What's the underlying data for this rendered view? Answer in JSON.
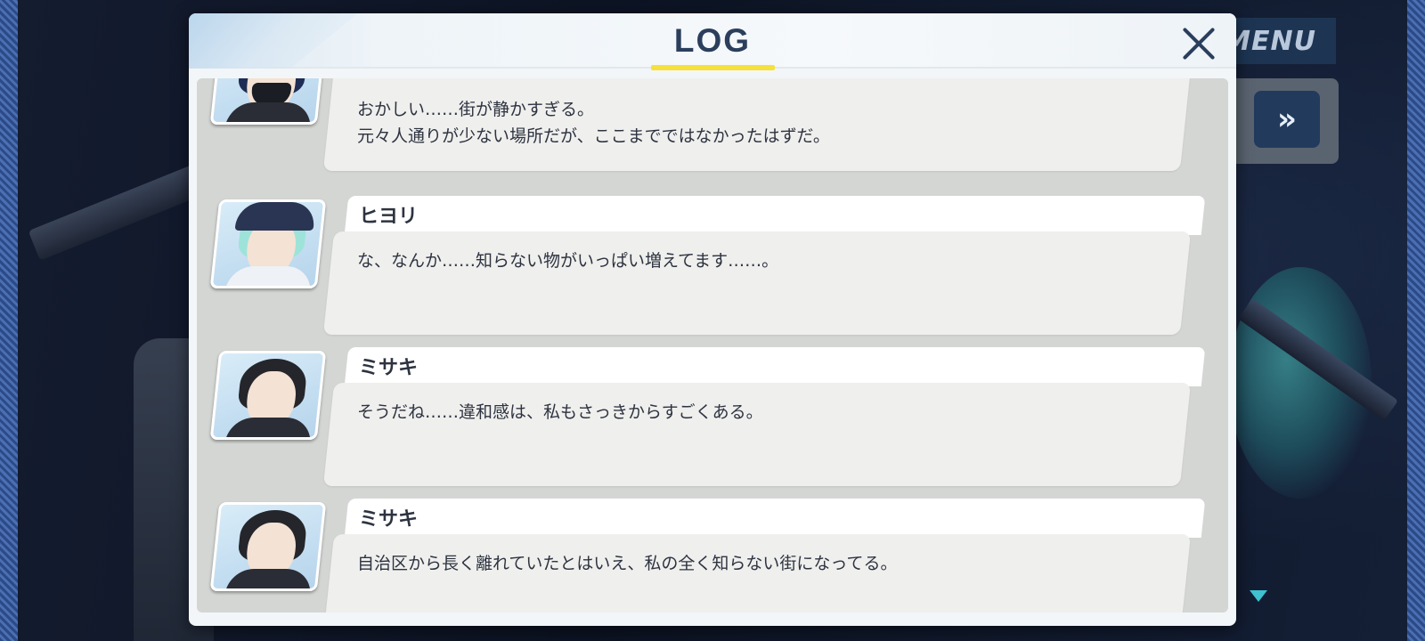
{
  "menu": {
    "label": "MENU",
    "fast_forward_icon": "»"
  },
  "dialog": {
    "title": "LOG"
  },
  "entries": [
    {
      "name": "",
      "avatar": "masked-girl-navy-cap",
      "lines": [
        "おかしい……街が静かすぎる。",
        "元々人通りが少ない場所だが、ここまでではなかったはずだ。"
      ]
    },
    {
      "name": "ヒヨリ",
      "avatar": "mint-hair-cap-girl",
      "lines": [
        "な、なんか……知らない物がいっぱい増えてます……。"
      ]
    },
    {
      "name": "ミサキ",
      "avatar": "dark-hair-girl",
      "lines": [
        "そうだね……違和感は、私もさっきからすごくある。"
      ]
    },
    {
      "name": "ミサキ",
      "avatar": "dark-hair-girl",
      "lines": [
        "自治区から長く離れていたとはいえ、私の全く知らない街になってる。"
      ]
    }
  ]
}
